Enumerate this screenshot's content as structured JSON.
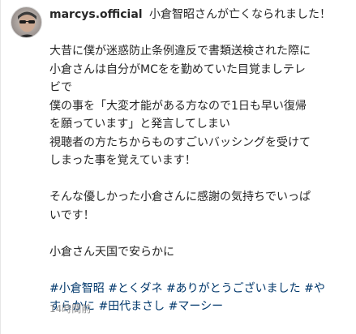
{
  "post": {
    "username": "marcys.official",
    "title": "小倉智昭さんが亡くなられました！",
    "lines": [
      "大昔に僕が迷惑防止条例違反で書類送検された際に",
      "小倉さんは自分がMCをを勤めていた目覚ましテレ",
      "ビで",
      "僕の事を「大変才能がある方なので1日も早い復帰",
      "を願っています」と発言してしまい",
      "視聴者の方たちからものすごいバッシングを受けて",
      "しまった事を覚えています！",
      "",
      "そんな優しかった小倉さんに感謝の気持ちでいっぱ",
      "いです！",
      "",
      "小倉さん天国で安らかに",
      ""
    ],
    "hashtags_line1": [
      "#小倉智昭",
      "#とくダネ",
      "#ありがとうございました",
      "#や"
    ],
    "hashtags_line2": [
      "すらかに",
      "#田代まさし",
      "#マーシー"
    ],
    "timestamp": "14時間前"
  },
  "colors": {
    "text": "#262626",
    "hashtag": "#00376b",
    "muted": "#8e8e8e"
  },
  "icons": {
    "avatar": "profile-avatar-icon"
  }
}
